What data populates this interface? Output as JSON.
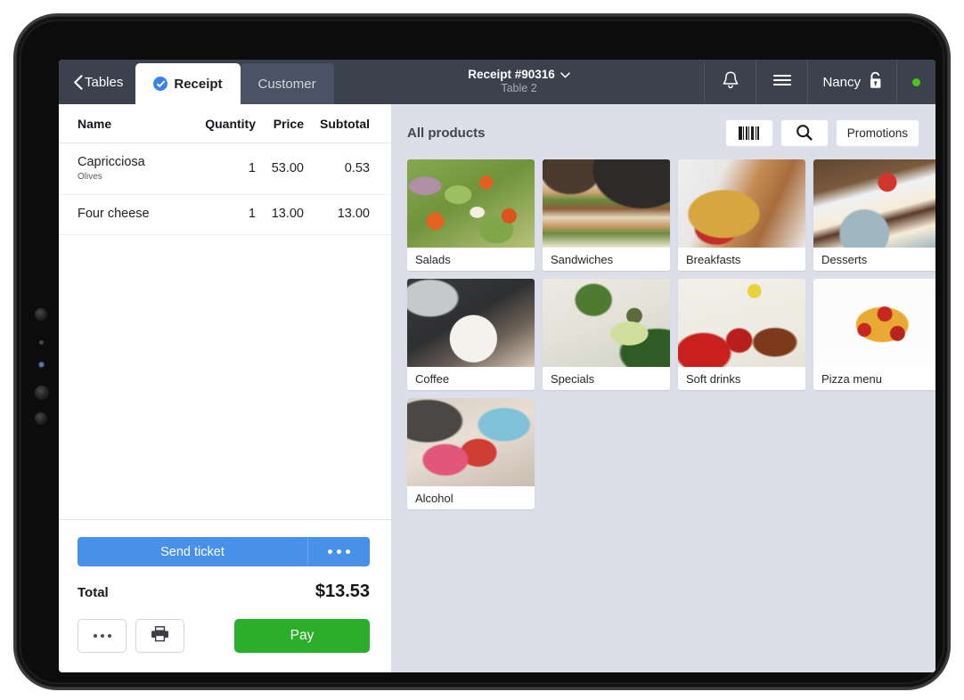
{
  "topbar": {
    "back_label": "Tables",
    "back_icon": "chevron-left-icon",
    "tabs": [
      {
        "label": "Receipt",
        "active": true,
        "icon": "check-circle-icon"
      },
      {
        "label": "Customer",
        "active": false
      }
    ],
    "receipt_title": "Receipt #90316",
    "receipt_title_caret": "chevron-down-icon",
    "table_label": "Table 2",
    "bell_icon": "bell-icon",
    "menu_icon": "hamburger-menu-icon",
    "user_name": "Nancy",
    "user_lock_icon": "unlocked-padlock-icon",
    "status_dot_icon": "online-status-dot",
    "status_color": "#4cc51a",
    "bar_color": "#3b414d"
  },
  "order": {
    "columns": {
      "name": "Name",
      "quantity": "Quantity",
      "price": "Price",
      "subtotal": "Subtotal"
    },
    "rows": [
      {
        "name": "Capricciosa",
        "note": "Olives",
        "quantity": "1",
        "price": "53.00",
        "subtotal": "0.53"
      },
      {
        "name": "Four cheese",
        "note": "",
        "quantity": "1",
        "price": "13.00",
        "subtotal": "13.00"
      }
    ],
    "send_ticket_label": "Send ticket",
    "send_ticket_more_icon": "ellipsis-icon",
    "send_ticket_color": "#4890e8",
    "total_label": "Total",
    "total_value": "$13.53",
    "more_icon": "ellipsis-icon",
    "print_icon": "printer-icon",
    "pay_label": "Pay",
    "pay_color": "#2bae2b"
  },
  "products": {
    "title": "All products",
    "barcode_icon": "barcode-icon",
    "search_icon": "search-icon",
    "promotions_label": "Promotions",
    "categories": [
      {
        "label": "Salads",
        "image": "salad-photo",
        "art": "ph-salad"
      },
      {
        "label": "Sandwiches",
        "image": "sandwich-photo",
        "art": "ph-sandwich"
      },
      {
        "label": "Breakfasts",
        "image": "waffle-photo",
        "art": "ph-waffle"
      },
      {
        "label": "Desserts",
        "image": "cake-slice-photo",
        "art": "ph-dessert"
      },
      {
        "label": "Coffee",
        "image": "latte-photo",
        "art": "ph-coffee"
      },
      {
        "label": "Specials",
        "image": "vegetables-photo",
        "art": "ph-specials"
      },
      {
        "label": "Soft drinks",
        "image": "cola-photo",
        "art": "ph-soft"
      },
      {
        "label": "Pizza menu",
        "image": "pizza-slice-photo",
        "art": "ph-pizza"
      },
      {
        "label": "Alcohol",
        "image": "cocktails-photo",
        "art": "ph-alcohol"
      }
    ],
    "panel_color": "#dcdee9"
  }
}
